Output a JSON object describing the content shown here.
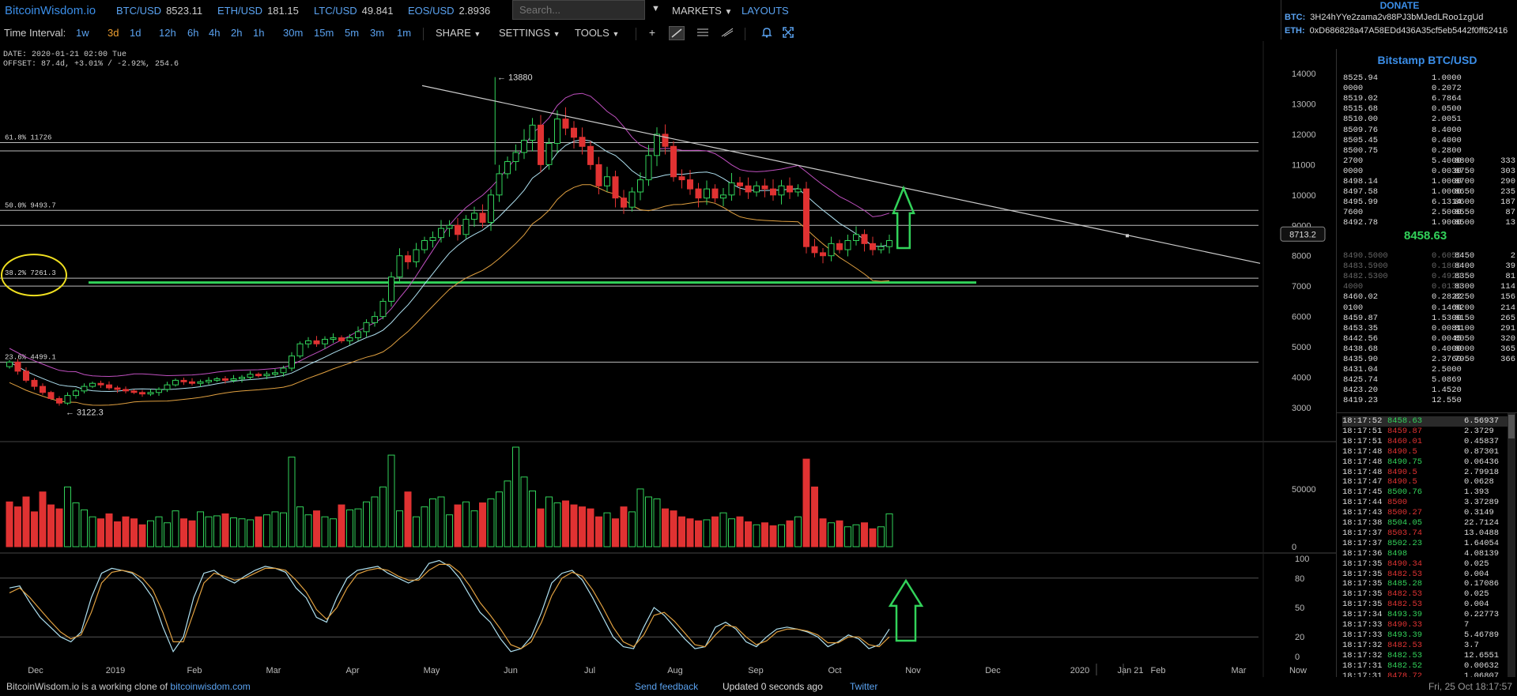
{
  "app": {
    "logo": "BitcoinWisdom.io"
  },
  "tickers": [
    {
      "pair": "BTC/USD",
      "value": "8523.11"
    },
    {
      "pair": "ETH/USD",
      "value": "181.15"
    },
    {
      "pair": "LTC/USD",
      "value": "49.841"
    },
    {
      "pair": "EOS/USD",
      "value": "2.8936"
    }
  ],
  "search": {
    "placeholder": "Search..."
  },
  "nav": {
    "markets": "MARKETS",
    "layouts": "LAYOUTS"
  },
  "donate": {
    "title": "DONATE",
    "btc_label": "BTC:",
    "btc_addr": "3H24hYYe2zama2v88PJ3bMJedLRoo1zgUd",
    "eth_label": "ETH:",
    "eth_addr": "0xD686828a47A58EDd436A35cf5eb5442f0ff62416"
  },
  "toolbar": {
    "interval_label": "Time Interval:",
    "intervals": [
      "1w",
      "3d",
      "1d",
      "12h",
      "6h",
      "4h",
      "2h",
      "1h",
      "30m",
      "15m",
      "5m",
      "3m",
      "1m"
    ],
    "active_interval": "3d",
    "share": "SHARE",
    "settings": "SETTINGS",
    "tools": "TOOLS"
  },
  "chart_info": {
    "date": "DATE: 2020-01-21 02:00 Tue",
    "offset": "OFFSET: 87.4d, +3.01% / -2.92%, 254.6"
  },
  "chart_data": {
    "type": "candlestick",
    "price_axis": [
      "14000",
      "13000",
      "12000",
      "11000",
      "10000",
      "9000",
      "8000",
      "7000",
      "6000",
      "5000",
      "4000",
      "3000"
    ],
    "ylim": [
      2300,
      14600
    ],
    "current_price_tag": "8713.2",
    "high_annotation": "13880",
    "low_annotation": "3122.3",
    "fib_levels": [
      {
        "label": "61.8% 11726",
        "price": 11726
      },
      {
        "label": "50.0% 9493.7",
        "price": 9493.7
      },
      {
        "label": "38.2% 7261.3",
        "price": 7261.3
      },
      {
        "label": "23.6% 4499.1",
        "price": 4499.1
      }
    ],
    "volume_axis": [
      "50000",
      "0"
    ],
    "stoch_axis": [
      "100",
      "80",
      "50",
      "20",
      "0"
    ],
    "x_labels": [
      "Dec",
      "2019",
      "Feb",
      "Mar",
      "Apr",
      "May",
      "Jun",
      "Jul",
      "Aug",
      "Sep",
      "Oct",
      "Nov",
      "Dec",
      "2020",
      "Jan 21",
      "Feb",
      "Mar",
      "Now"
    ],
    "close_series": [
      4500,
      4200,
      3900,
      3700,
      3500,
      3300,
      3150,
      3400,
      3550,
      3700,
      3800,
      3750,
      3650,
      3600,
      3550,
      3500,
      3450,
      3500,
      3600,
      3750,
      3900,
      3850,
      3800,
      3850,
      3900,
      3950,
      3900,
      3950,
      4000,
      4100,
      4050,
      4100,
      4150,
      4300,
      4700,
      5100,
      5200,
      5100,
      5250,
      5300,
      5200,
      5300,
      5500,
      5800,
      6000,
      6500,
      7300,
      8000,
      7800,
      8200,
      8500,
      8600,
      8900,
      9000,
      8700,
      9200,
      9400,
      9100,
      10000,
      10700,
      11100,
      11400,
      11800,
      12300,
      11000,
      11700,
      12500,
      12200,
      11900,
      11600,
      11000,
      10300,
      10600,
      9900,
      9600,
      10100,
      10500,
      11300,
      12000,
      11600,
      10600,
      10500,
      10200,
      9900,
      10200,
      9900,
      10000,
      10400,
      10300,
      10100,
      10300,
      10200,
      10000,
      10300,
      10100,
      10200,
      8300,
      8100,
      8000,
      8400,
      8200,
      8500,
      8700,
      8400,
      8200,
      8300,
      8500
    ],
    "volume_series": [
      45,
      40,
      50,
      35,
      55,
      42,
      38,
      60,
      44,
      37,
      30,
      28,
      33,
      25,
      30,
      28,
      22,
      26,
      30,
      24,
      36,
      28,
      26,
      35,
      30,
      31,
      33,
      29,
      28,
      27,
      30,
      32,
      35,
      34,
      90,
      40,
      32,
      36,
      30,
      28,
      42,
      37,
      38,
      45,
      50,
      60,
      92,
      36,
      55,
      30,
      40,
      48,
      50,
      32,
      42,
      45,
      36,
      44,
      48,
      55,
      66,
      100,
      70,
      56,
      38,
      50,
      44,
      46,
      42,
      40,
      38,
      30,
      34,
      28,
      40,
      35,
      58,
      50,
      48,
      38,
      36,
      30,
      28,
      26,
      27,
      30,
      34,
      28,
      30,
      25,
      22,
      24,
      21,
      22,
      26,
      30,
      88,
      60,
      28,
      24,
      26,
      20,
      22,
      24,
      18,
      20,
      33
    ],
    "stoch_k": [
      70,
      72,
      55,
      40,
      30,
      20,
      15,
      25,
      60,
      85,
      90,
      88,
      85,
      75,
      60,
      30,
      5,
      20,
      60,
      85,
      88,
      80,
      75,
      82,
      88,
      92,
      90,
      86,
      70,
      60,
      40,
      35,
      60,
      80,
      88,
      90,
      92,
      85,
      80,
      75,
      80,
      95,
      98,
      92,
      80,
      62,
      45,
      35,
      18,
      5,
      8,
      20,
      45,
      75,
      85,
      88,
      78,
      60,
      40,
      20,
      10,
      8,
      30,
      50,
      42,
      30,
      18,
      8,
      10,
      30,
      35,
      28,
      15,
      10,
      20,
      28,
      30,
      28,
      25,
      20,
      10,
      15,
      22,
      18,
      8,
      12,
      28
    ],
    "stoch_d": [
      65,
      70,
      60,
      48,
      36,
      25,
      18,
      22,
      45,
      75,
      86,
      88,
      86,
      80,
      68,
      45,
      15,
      15,
      45,
      75,
      85,
      82,
      78,
      80,
      85,
      90,
      90,
      88,
      78,
      66,
      48,
      38,
      50,
      70,
      84,
      88,
      90,
      88,
      82,
      78,
      78,
      88,
      94,
      94,
      86,
      72,
      55,
      42,
      28,
      12,
      8,
      15,
      35,
      62,
      80,
      86,
      82,
      68,
      50,
      30,
      15,
      10,
      22,
      42,
      45,
      36,
      24,
      12,
      10,
      22,
      32,
      30,
      20,
      12,
      16,
      25,
      28,
      28,
      26,
      22,
      14,
      14,
      20,
      20,
      12,
      10,
      20
    ]
  },
  "orderbook": {
    "title": "Bitstamp BTC/USD",
    "asks": [
      [
        "8525.94",
        "1.0000",
        "",
        ""
      ],
      [
        "0000",
        "0.2072",
        "",
        ""
      ],
      [
        "8519.02",
        "6.7864",
        "",
        ""
      ],
      [
        "8515.68",
        "0.0500",
        "",
        ""
      ],
      [
        "8510.00",
        "2.0051",
        "",
        ""
      ],
      [
        "8509.76",
        "8.4000",
        "",
        ""
      ],
      [
        "8505.45",
        "0.4000",
        "",
        ""
      ],
      [
        "8500.75",
        "0.2800",
        "",
        ""
      ],
      [
        "2700",
        "5.4000",
        "8800",
        "333"
      ],
      [
        "0000",
        "0.0030",
        "8750",
        "303"
      ],
      [
        "8498.14",
        "1.0000",
        "8700",
        "290"
      ],
      [
        "8497.58",
        "1.0000",
        "8650",
        "235"
      ],
      [
        "8495.99",
        "6.1314",
        "8600",
        "187"
      ],
      [
        "7600",
        "2.5000",
        "8550",
        "87"
      ],
      [
        "8492.78",
        "1.9000",
        "8500",
        "13"
      ]
    ],
    "last_price": "8458.63",
    "bids": [
      [
        "8490.5000",
        "0.6055",
        "8450",
        "2"
      ],
      [
        "8483.5900",
        "0.1800",
        "8400",
        "39"
      ],
      [
        "8482.5300",
        "0.4929",
        "8350",
        "81"
      ],
      [
        "4000",
        "0.0130",
        "8300",
        "114"
      ],
      [
        "8460.02",
        "0.2822",
        "8250",
        "156"
      ],
      [
        "0100",
        "0.1460",
        "8200",
        "214"
      ],
      [
        "8459.87",
        "1.5300",
        "8150",
        "265"
      ],
      [
        "8453.35",
        "0.0081",
        "8100",
        "291"
      ],
      [
        "8442.56",
        "0.0045",
        "8050",
        "320"
      ],
      [
        "8438.68",
        "0.4000",
        "8000",
        "365"
      ],
      [
        "8435.90",
        "2.3760",
        "7950",
        "366"
      ],
      [
        "8431.04",
        "2.5000",
        "",
        ""
      ],
      [
        "8425.74",
        "5.0869",
        "",
        ""
      ],
      [
        "8423.20",
        "1.4520",
        "",
        ""
      ],
      [
        "8419.23",
        "12.550",
        "",
        ""
      ]
    ],
    "trades": [
      [
        "18:17:52",
        "8458.63",
        "6.56937",
        "green"
      ],
      [
        "18:17:51",
        "8459.87",
        "2.3729",
        "red"
      ],
      [
        "18:17:51",
        "8460.01",
        "0.45837",
        "red"
      ],
      [
        "18:17:48",
        "8490.5",
        "0.87301",
        "red"
      ],
      [
        "18:17:48",
        "8490.75",
        "0.06436",
        "green"
      ],
      [
        "18:17:48",
        "8490.5",
        "2.79918",
        "red"
      ],
      [
        "18:17:47",
        "8490.5",
        "0.0628",
        "red"
      ],
      [
        "18:17:45",
        "8500.76",
        "1.393",
        "green"
      ],
      [
        "18:17:44",
        "8500",
        "3.37289",
        "red"
      ],
      [
        "18:17:43",
        "8500.27",
        "0.3149",
        "red"
      ],
      [
        "18:17:38",
        "8504.05",
        "22.7124",
        "green"
      ],
      [
        "18:17:37",
        "8503.74",
        "13.0488",
        "red"
      ],
      [
        "18:17:37",
        "8502.23",
        "1.64054",
        "green"
      ],
      [
        "18:17:36",
        "8498",
        "4.08139",
        "green"
      ],
      [
        "18:17:35",
        "8490.34",
        "0.025",
        "red"
      ],
      [
        "18:17:35",
        "8482.53",
        "0.004",
        "red"
      ],
      [
        "18:17:35",
        "8485.28",
        "0.17086",
        "green"
      ],
      [
        "18:17:35",
        "8482.53",
        "0.025",
        "red"
      ],
      [
        "18:17:35",
        "8482.53",
        "0.004",
        "red"
      ],
      [
        "18:17:34",
        "8493.39",
        "0.22773",
        "green"
      ],
      [
        "18:17:33",
        "8490.33",
        "7",
        "red"
      ],
      [
        "18:17:33",
        "8493.39",
        "5.46789",
        "green"
      ],
      [
        "18:17:32",
        "8482.53",
        "3.7",
        "red"
      ],
      [
        "18:17:32",
        "8482.53",
        "12.6551",
        "green"
      ],
      [
        "18:17:31",
        "8482.52",
        "0.00632",
        "green"
      ],
      [
        "18:17:31",
        "8478.72",
        "1.06807",
        "red"
      ]
    ]
  },
  "footer": {
    "clone_text": "BitcoinWisdom.io is a working clone of ",
    "clone_link": "bitcoinwisdom.com",
    "feedback": "Send feedback",
    "updated": "Updated 0 seconds ago",
    "twitter": "Twitter",
    "clock": "Fri, 25 Oct 18:17:57"
  },
  "colors": {
    "up": "#32d25a",
    "down": "#e03232",
    "accent": "#3b8ee8",
    "annotation": "#f0e020"
  }
}
